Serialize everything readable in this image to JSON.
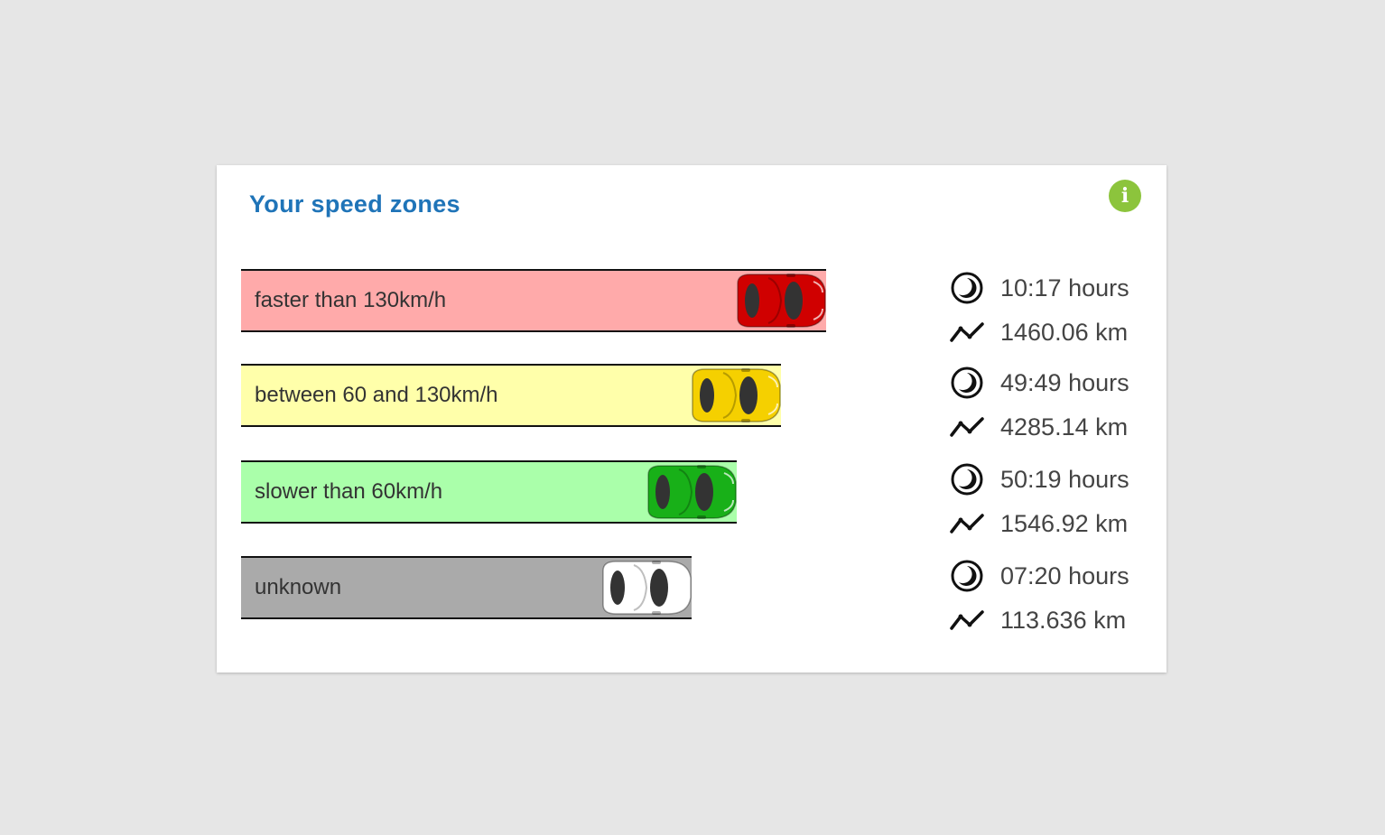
{
  "widget": {
    "title": "Your speed zones",
    "info_icon": "info-icon",
    "info_glyph": "i",
    "accent_color": "#1f74b8",
    "info_color": "#8cc43c"
  },
  "zones": [
    {
      "label": "faster than 130km/h",
      "hours": "10:17 hours",
      "distance": "1460.06 km",
      "bar_color": "#ffaaaa",
      "car_color": "#d00000",
      "car_icon": "red-car-icon"
    },
    {
      "label": "between 60 and 130km/h",
      "hours": "49:49 hours",
      "distance": "4285.14 km",
      "bar_color": "#ffffaa",
      "car_color": "#f5d000",
      "car_icon": "yellow-car-icon"
    },
    {
      "label": "slower than 60km/h",
      "hours": "50:19 hours",
      "distance": "1546.92 km",
      "bar_color": "#aaffaa",
      "car_color": "#18b018",
      "car_icon": "green-car-icon"
    },
    {
      "label": "unknown",
      "hours": "07:20 hours",
      "distance": "113.636 km",
      "bar_color": "#aaaaaa",
      "car_color": "#ffffff",
      "car_icon": "white-car-icon"
    }
  ],
  "icons": {
    "time": "clock-icon",
    "distance": "route-icon"
  }
}
